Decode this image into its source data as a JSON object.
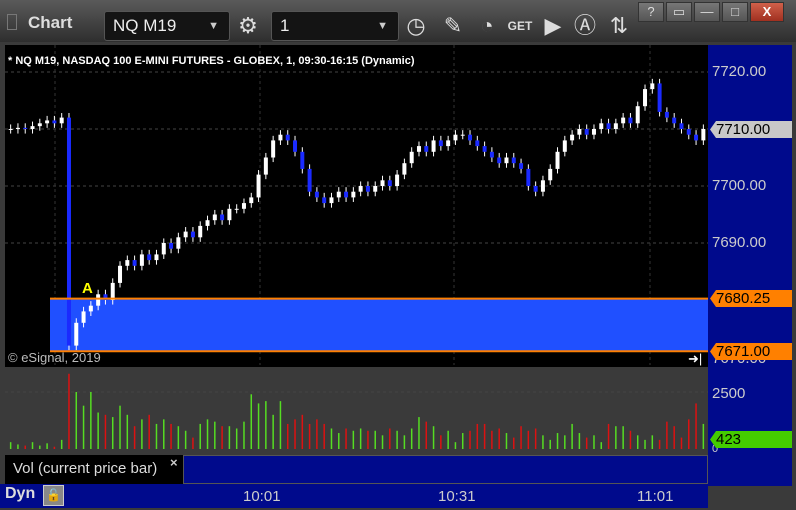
{
  "window": {
    "title": "Chart",
    "symbol": "NQ M19",
    "interval": "1",
    "help": "?",
    "minimize": "—",
    "maximize": "□",
    "close": "X"
  },
  "chart": {
    "info": "* NQ M19, NASDAQ 100 E-MINI FUTURES - GLOBEX, 1, 09:30-16:15 (Dynamic)",
    "watermark": "© eSignal, 2019",
    "marker": "A",
    "price_labels": [
      "7720.00",
      "7710.00",
      "7700.00",
      "7690.00",
      "7670.00"
    ],
    "last_price": "7710.00",
    "zone_high": "7680.25",
    "zone_low": "7671.00",
    "zone_color": "#2050ff",
    "line_color": "#ff8000"
  },
  "volume": {
    "label": "Vol (current price bar)",
    "close": "×",
    "axis_label": "2500",
    "zero": "0",
    "current": "423"
  },
  "footer": {
    "mode": "Dyn",
    "times": [
      "10:01",
      "10:31",
      "11:01"
    ]
  },
  "chart_data": {
    "type": "candlestick",
    "ylim": [
      7666,
      7724
    ],
    "closes": [
      7710,
      7710.2,
      7710,
      7710.5,
      7711,
      7711.5,
      7711,
      7712,
      7672,
      7676,
      7678,
      7679,
      7681,
      7680,
      7683,
      7686,
      7687,
      7686,
      7688,
      7687,
      7688,
      7690,
      7689,
      7691,
      7692,
      7691,
      7693,
      7694,
      7695,
      7694,
      7696,
      7696,
      7697,
      7698,
      7702,
      7705,
      7708,
      7709,
      7708,
      7706,
      7703,
      7699,
      7698,
      7697,
      7698,
      7699,
      7698,
      7699,
      7700,
      7699,
      7700,
      7701,
      7700,
      7702,
      7704,
      7706,
      7707,
      7706,
      7708,
      7707,
      7708,
      7709,
      7709,
      7708,
      7707,
      7706,
      7705,
      7704,
      7705,
      7704,
      7703,
      7700,
      7699,
      7701,
      7703,
      7706,
      7708,
      7709,
      7710,
      7709,
      7710,
      7711,
      7710,
      7711,
      7712,
      7711,
      7714,
      7717,
      7718,
      7713,
      7712,
      7711,
      7710,
      7709,
      7708,
      7710
    ],
    "volumes": [
      300,
      200,
      150,
      300,
      150,
      250,
      100,
      400,
      3300,
      2500,
      1900,
      2500,
      1600,
      1500,
      1400,
      1900,
      1500,
      1000,
      1300,
      1500,
      1100,
      1300,
      1100,
      1000,
      800,
      500,
      1100,
      1300,
      1200,
      1000,
      1000,
      900,
      1200,
      2400,
      2000,
      2100,
      1500,
      2100,
      1100,
      1300,
      1500,
      1100,
      1300,
      1100,
      900,
      700,
      900,
      800,
      900,
      800,
      800,
      600,
      900,
      800,
      600,
      900,
      1400,
      1200,
      1000,
      600,
      800,
      300,
      700,
      800,
      1100,
      1100,
      800,
      900,
      700,
      500,
      1000,
      800,
      900,
      600,
      400,
      700,
      600,
      1100,
      700,
      500,
      600,
      300,
      1100,
      1000,
      1000,
      800,
      600,
      400,
      600,
      400,
      1200,
      1000,
      500,
      1300,
      2000,
      1100
    ]
  }
}
